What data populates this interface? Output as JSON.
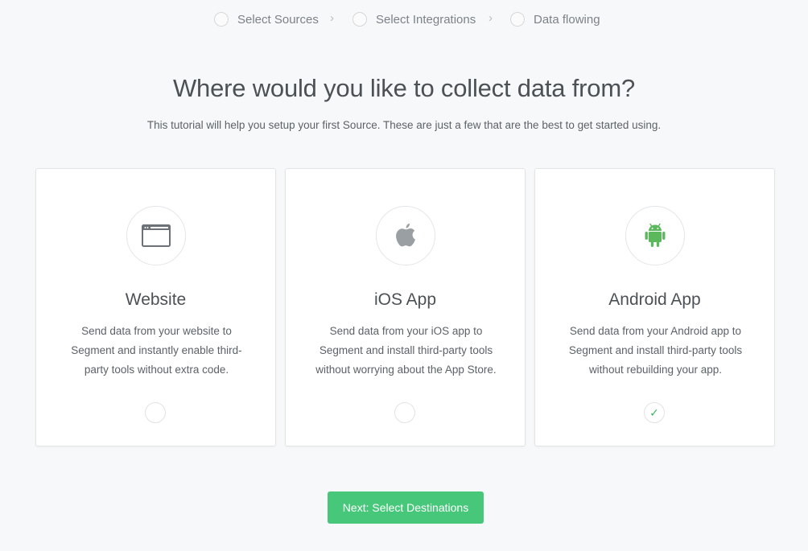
{
  "stepper": {
    "steps": [
      {
        "label": "Select Sources"
      },
      {
        "label": "Select Integrations"
      },
      {
        "label": "Data flowing"
      }
    ],
    "separator": "›"
  },
  "heading": {
    "title": "Where would you like to collect data from?",
    "subtitle": "This tutorial will help you setup your first Source. These are just a few that are the best to get started using."
  },
  "cards": [
    {
      "icon": "browser-window-icon",
      "title": "Website",
      "description": "Send data from your website to Segment and instantly enable third-party tools without extra code.",
      "selected": false
    },
    {
      "icon": "apple-icon",
      "title": "iOS App",
      "description": "Send data from your iOS app to Segment and install third-party tools without worrying about the App Store.",
      "selected": false
    },
    {
      "icon": "android-icon",
      "title": "Android App",
      "description": "Send data from your Android app to Segment and install third-party tools without rebuilding your app.",
      "selected": true,
      "check_glyph": "✓"
    }
  ],
  "next_button": {
    "label": "Next: Select Destinations"
  },
  "colors": {
    "accent": "#47c77a",
    "check": "#3cb65e",
    "android": "#5cb85c",
    "apple": "#9a9fa4"
  }
}
